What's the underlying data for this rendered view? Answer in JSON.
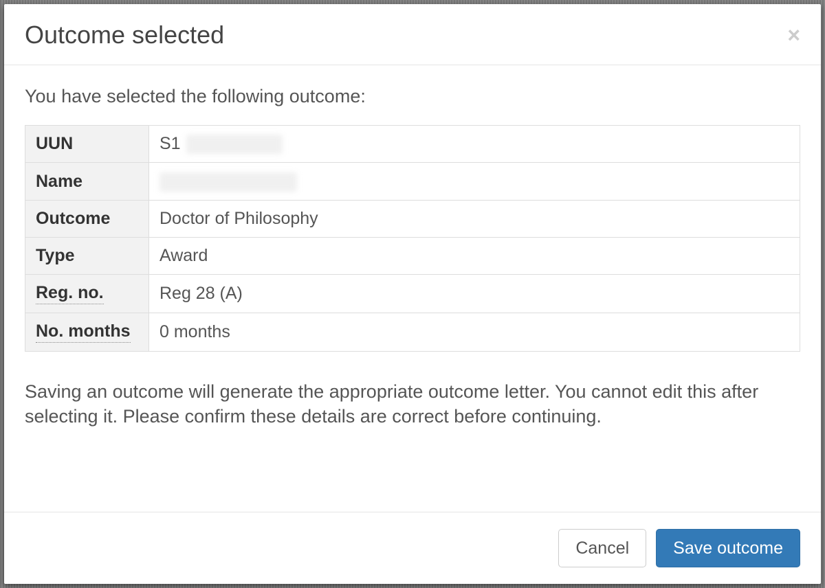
{
  "modal": {
    "title": "Outcome selected",
    "close_glyph": "×",
    "intro": "You have selected the following outcome:",
    "fields": {
      "uun": {
        "label": "UUN",
        "prefix": "S1",
        "value_redacted": true
      },
      "name": {
        "label": "Name",
        "value_redacted": true
      },
      "outcome": {
        "label": "Outcome",
        "value": "Doctor of Philosophy"
      },
      "type": {
        "label": "Type",
        "value": "Award"
      },
      "reg_no": {
        "label": "Reg. no.",
        "value": "Reg 28 (A)"
      },
      "no_months": {
        "label": "No. months",
        "value": "0 months"
      }
    },
    "warning": "Saving an outcome will generate the appropriate outcome letter. You cannot edit this after selecting it. Please confirm these details are correct before continuing.",
    "buttons": {
      "cancel": "Cancel",
      "save": "Save outcome"
    }
  }
}
